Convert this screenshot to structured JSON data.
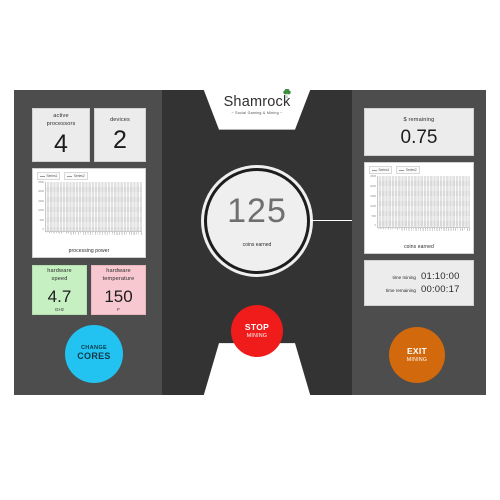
{
  "brand": {
    "name": "Shamrock",
    "tagline": "~ Social Gaming & Mining ~",
    "clover_icon": "shamrock-icon",
    "clover_color": "#3e8e41"
  },
  "left_panel": {
    "tiles": [
      {
        "label": "active\nprocessors",
        "value": "4",
        "unit": "",
        "color": "#ececec"
      },
      {
        "label": "devices",
        "value": "2",
        "unit": "",
        "color": "#ececec"
      },
      {
        "label": "hardware\nspeed",
        "value": "4.7",
        "unit": "GHz",
        "color": "#c6f0c2"
      },
      {
        "label": "hardware\ntemperature",
        "value": "150",
        "unit": "F",
        "color": "#f7c8cf"
      }
    ],
    "processors_label": "active processors",
    "processors_value": "4",
    "devices_label": "devices",
    "devices_value": "2",
    "speed_label": "hardware speed",
    "speed_value": "4.7",
    "speed_unit": "GHz",
    "temp_label": "hardware temperature",
    "temp_value": "150",
    "temp_unit": "F",
    "button": {
      "line1": "CHANGE",
      "line2": "CORES",
      "color": "#22c3f0"
    }
  },
  "center_panel": {
    "dial_value": "125",
    "dial_label": "coins earned",
    "button": {
      "line1": "STOP",
      "line2": "MINING",
      "color": "#f01b1b"
    }
  },
  "right_panel": {
    "remaining_label": "$ remaining",
    "remaining_value": "0.75",
    "time_mining_label": "time mining",
    "time_mining_value": "01:10:00",
    "time_remaining_label": "time remaining",
    "time_remaining_value": "00:00:17",
    "button": {
      "line1": "EXIT",
      "line2": "MINING",
      "color": "#d2690c"
    }
  },
  "chart_data": [
    {
      "type": "line",
      "id": "processing-power",
      "title": "processing power",
      "caption": "processing power",
      "xlabel": "",
      "ylabel": "",
      "ylim": [
        0,
        2500
      ],
      "yticks": [
        "2500",
        "2000",
        "1500",
        "1000",
        "500",
        "0"
      ],
      "grid": true,
      "legend_position": "top-left",
      "legend": [
        "Series1",
        "Series2"
      ],
      "categories": [
        "0",
        "1",
        "2",
        "3",
        "4",
        "5",
        "6",
        "7",
        "8",
        "9",
        "10",
        "11",
        "12",
        "13",
        "14",
        "15",
        "16",
        "17",
        "18",
        "19",
        "20",
        "21",
        "22",
        "23",
        "24",
        "25",
        "26",
        "27",
        "28",
        "29",
        "30",
        "31",
        "32",
        "33",
        "34",
        "35",
        "36",
        "37",
        "38",
        "39"
      ],
      "series": [
        {
          "name": "Series1",
          "values": [
            0,
            0,
            0,
            0,
            0,
            0,
            0,
            0,
            0,
            0,
            0,
            0,
            0,
            0,
            0,
            0,
            0,
            0,
            0,
            0,
            0,
            0,
            0,
            0,
            0,
            0,
            0,
            0,
            0,
            0,
            0,
            0,
            0,
            0,
            0,
            0,
            0,
            0,
            0,
            0
          ]
        },
        {
          "name": "Series2",
          "values": [
            0,
            0,
            0,
            0,
            0,
            0,
            0,
            0,
            0,
            0,
            0,
            0,
            0,
            0,
            0,
            0,
            0,
            0,
            0,
            0,
            0,
            0,
            0,
            0,
            0,
            0,
            0,
            0,
            0,
            0,
            0,
            0,
            0,
            0,
            0,
            0,
            0,
            0,
            0,
            0
          ]
        }
      ]
    },
    {
      "type": "line",
      "id": "coins-earned",
      "title": "coins earned",
      "caption": "coins earned",
      "xlabel": "",
      "ylabel": "",
      "ylim": [
        0,
        2500
      ],
      "yticks": [
        "2500",
        "2000",
        "1500",
        "1000",
        "500",
        "0"
      ],
      "grid": true,
      "legend_position": "top-left",
      "legend": [
        "Series1",
        "Series2"
      ],
      "categories": [
        "0",
        "1",
        "2",
        "3",
        "4",
        "5",
        "6",
        "7",
        "8",
        "9",
        "10",
        "11",
        "12",
        "13",
        "14",
        "15",
        "16",
        "17",
        "18",
        "19",
        "20",
        "21",
        "22",
        "23",
        "24",
        "25",
        "26",
        "27",
        "28",
        "29",
        "30",
        "31",
        "32",
        "33",
        "34",
        "35",
        "36",
        "37",
        "38",
        "39"
      ],
      "series": [
        {
          "name": "Series1",
          "values": [
            0,
            0,
            0,
            0,
            0,
            0,
            0,
            0,
            0,
            0,
            0,
            0,
            0,
            0,
            0,
            0,
            0,
            0,
            0,
            0,
            0,
            0,
            0,
            0,
            0,
            0,
            0,
            0,
            0,
            0,
            0,
            0,
            0,
            0,
            0,
            0,
            0,
            0,
            0,
            0
          ]
        },
        {
          "name": "Series2",
          "values": [
            0,
            0,
            0,
            0,
            0,
            0,
            0,
            0,
            0,
            0,
            0,
            0,
            0,
            0,
            0,
            0,
            0,
            0,
            0,
            0,
            0,
            0,
            0,
            0,
            0,
            0,
            0,
            0,
            0,
            0,
            0,
            0,
            0,
            0,
            0,
            0,
            0,
            0,
            0,
            0
          ]
        }
      ]
    }
  ]
}
